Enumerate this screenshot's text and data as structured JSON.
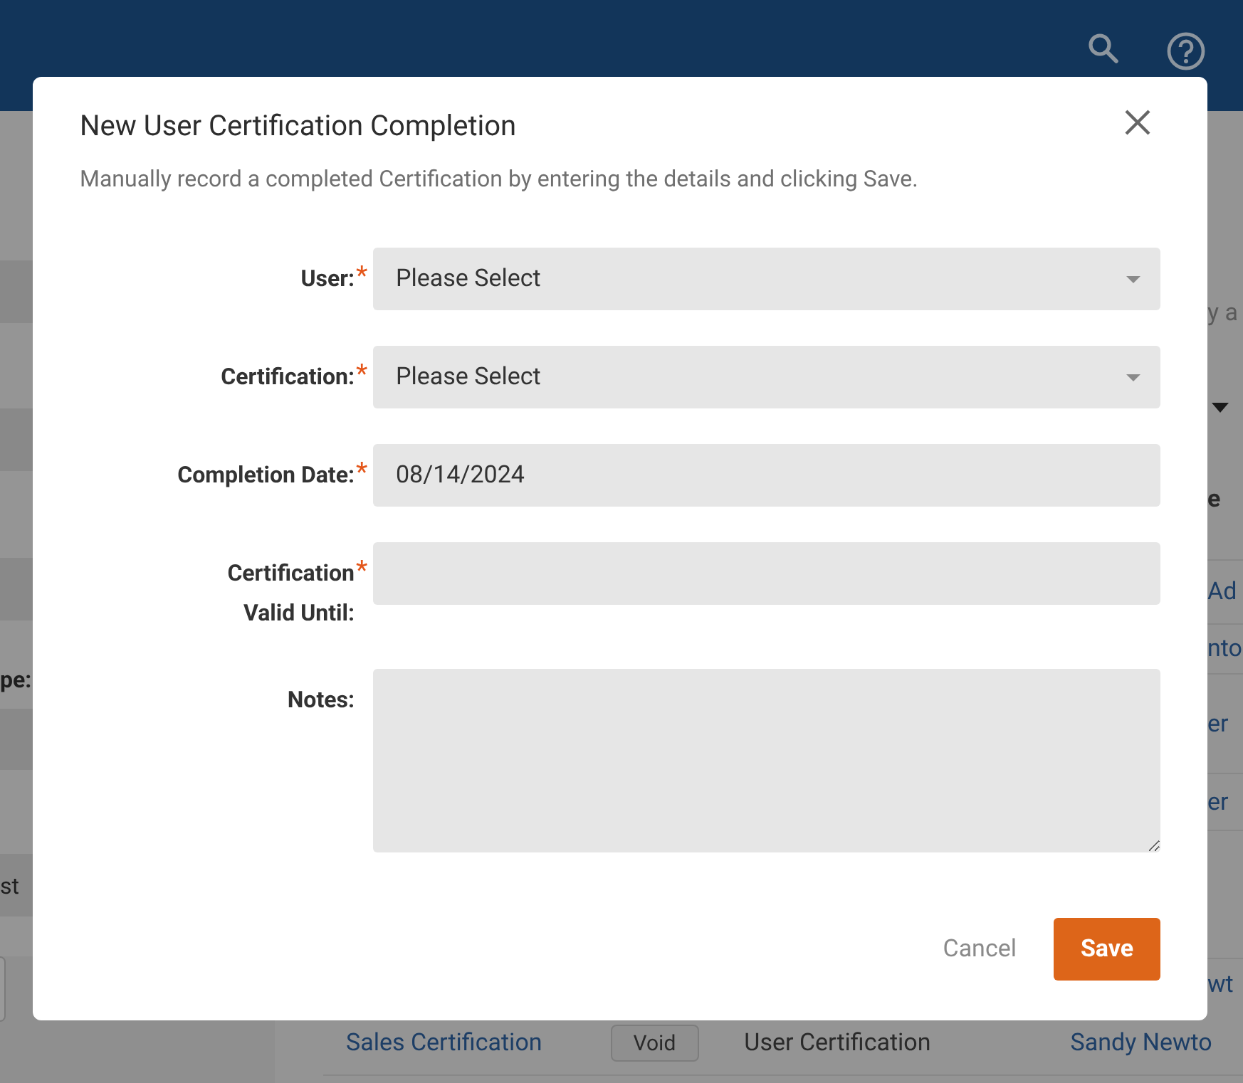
{
  "background": {
    "left_texts": [
      {
        "text": "pe:",
        "kind": "label"
      },
      {
        "text": "st",
        "kind": "plain"
      }
    ],
    "right_texts": [
      "y a",
      "e",
      "Ad",
      "nto",
      "er",
      "er",
      "wt"
    ],
    "bottom_row": {
      "certification": "Sales Certification",
      "void_button": "Void",
      "type": "User Certification",
      "user": "Sandy Newto"
    }
  },
  "dialog": {
    "title": "New User Certification Completion",
    "subtitle": "Manually record a completed Certification by entering the details and clicking Save.",
    "fields": [
      {
        "label": "User:",
        "required_mark": "*",
        "kind": "select",
        "placeholder": "Please Select"
      },
      {
        "label": "Certification:",
        "required_mark": "*",
        "kind": "select",
        "placeholder": "Please Select"
      },
      {
        "label": "Completion Date:",
        "required_mark": "*",
        "kind": "text",
        "value": "08/14/2024"
      },
      {
        "label": "Certification Valid Until:",
        "required_mark": "*",
        "kind": "text"
      },
      {
        "label": "Notes:",
        "kind": "textarea"
      }
    ],
    "cancel": "Cancel",
    "save": "Save"
  }
}
